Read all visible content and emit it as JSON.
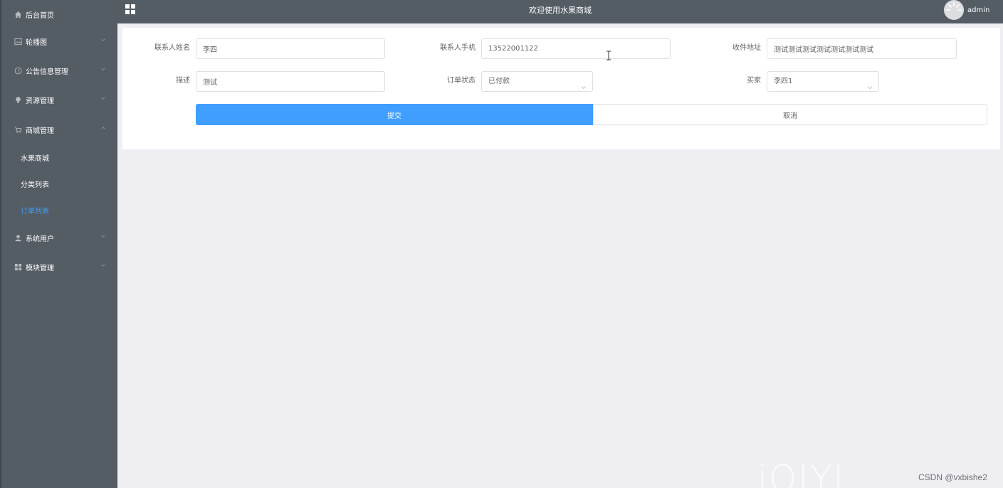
{
  "header": {
    "title": "欢迎使用水果商城",
    "username": "admin"
  },
  "sidebar": {
    "items": [
      {
        "label": "后台首页",
        "icon": "home-icon",
        "expandable": false
      },
      {
        "label": "轮播图",
        "icon": "image-icon",
        "expandable": true
      },
      {
        "label": "公告信息管理",
        "icon": "info-circle-icon",
        "expandable": true
      },
      {
        "label": "资源管理",
        "icon": "bulb-icon",
        "expandable": true
      },
      {
        "label": "商城管理",
        "icon": "cart-icon",
        "expandable": true,
        "expanded": true
      },
      {
        "label": "系统用户",
        "icon": "user-icon",
        "expandable": true
      },
      {
        "label": "模块管理",
        "icon": "grid-icon",
        "expandable": true
      }
    ],
    "submenu": [
      {
        "label": "水果商城",
        "active": false
      },
      {
        "label": "分类列表",
        "active": false
      },
      {
        "label": "订单列表",
        "active": true
      }
    ]
  },
  "form": {
    "contact_name": {
      "label": "联系人姓名",
      "value": "李四"
    },
    "contact_phone": {
      "label": "联系人手机",
      "value": "13522001122"
    },
    "address": {
      "label": "收件地址",
      "value": "测试测试测试测试测试测试测试"
    },
    "description": {
      "label": "描述",
      "value": "测试"
    },
    "order_status": {
      "label": "订单状态",
      "value": "已付款"
    },
    "buyer": {
      "label": "买家",
      "value": "李四1"
    },
    "submit_label": "提交",
    "cancel_label": "取消"
  },
  "watermark": {
    "logo": "iQIYI",
    "text": "CSDN @vxbishe2"
  },
  "colors": {
    "sidebar_bg": "#545c64",
    "accent": "#409eff",
    "content_bg": "#efeef3"
  }
}
